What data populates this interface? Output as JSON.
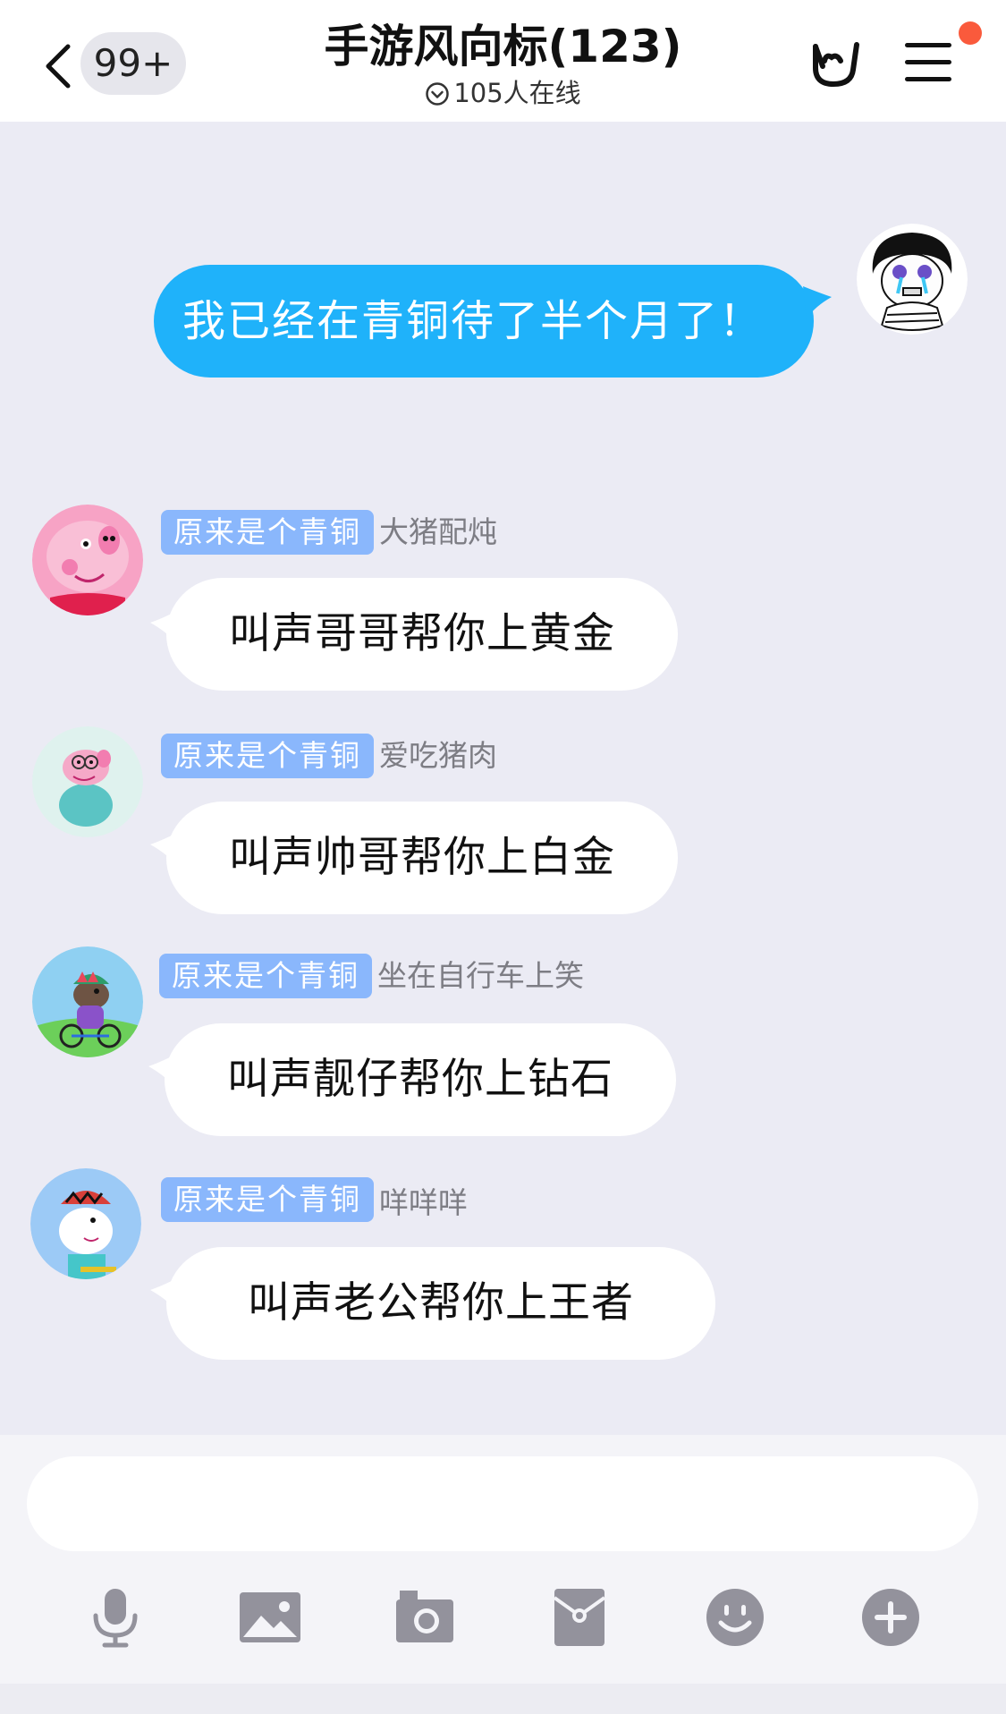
{
  "header": {
    "back_badge": "99+",
    "title": "手游风向标(123)",
    "online_text": "105人在线"
  },
  "self_message": {
    "text": "我已经在青铜待了半个月了！"
  },
  "messages": [
    {
      "tag": "原来是个青铜",
      "nickname": "大猪配炖",
      "text": "叫声哥哥帮你上黄金",
      "avatar": "peppa-pig-avatar"
    },
    {
      "tag": "原来是个青铜",
      "nickname": "爱吃猪肉",
      "text": "叫声帅哥帮你上白金",
      "avatar": "daddy-pig-avatar"
    },
    {
      "tag": "原来是个青铜",
      "nickname": "坐在自行车上笑",
      "text": "叫声靓仔帮你上钻石",
      "avatar": "danny-dog-avatar"
    },
    {
      "tag": "原来是个青铜",
      "nickname": "咩咩咩",
      "text": "叫声老公帮你上王者",
      "avatar": "suzy-sheep-avatar"
    }
  ],
  "input": {
    "value": "",
    "placeholder": ""
  },
  "toolbar": [
    {
      "icon": "microphone-icon"
    },
    {
      "icon": "image-icon"
    },
    {
      "icon": "camera-icon"
    },
    {
      "icon": "red-packet-icon"
    },
    {
      "icon": "emoji-icon"
    },
    {
      "icon": "plus-icon"
    }
  ],
  "colors": {
    "self_bubble": "#1fb2fa",
    "tag": "#8ab7fc",
    "background": "#ebebf4",
    "notification_dot": "#fa5a3c"
  }
}
